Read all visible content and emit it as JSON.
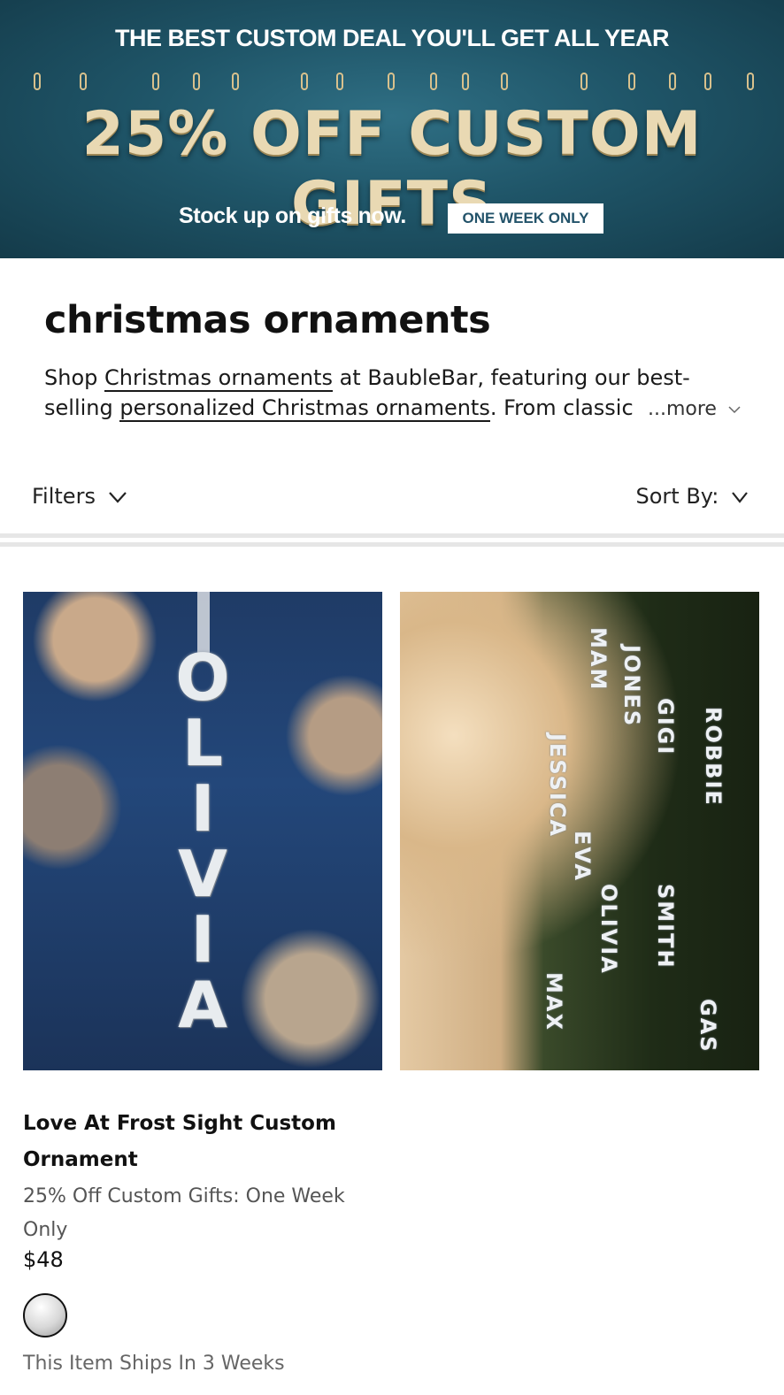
{
  "banner": {
    "kicker": "THE BEST CUSTOM DEAL YOU'LL GET ALL YEAR",
    "headline": "25% OFF CUSTOM GIFTS",
    "subtext": "Stock up on gifts now.",
    "badge": "ONE WEEK ONLY"
  },
  "page": {
    "title": "christmas ornaments",
    "intro_prefix": "Shop ",
    "intro_link1": "Christmas ornaments",
    "intro_mid": " at BaubleBar, featuring our best-selling ",
    "intro_link2": "personalized Christmas ornaments",
    "intro_suffix": ". From classic",
    "more_label": "...more"
  },
  "toolbar": {
    "filters_label": "Filters",
    "sort_label": "Sort By:"
  },
  "product": {
    "name": "Love At Frost Sight Custom Ornament",
    "promo": "25% Off Custom Gifts: One Week Only",
    "price": "$48",
    "shipping": "This Item Ships In 3 Weeks",
    "image_letters": [
      "O",
      "L",
      "I",
      "V",
      "I",
      "A"
    ],
    "tree_tags": [
      "MAM",
      "JONES",
      "GIGI",
      "ROBBIE",
      "JESSICA",
      "EVA",
      "OLIVIA",
      "SMITH",
      "MAX",
      "GAS"
    ]
  },
  "colors": {
    "banner_teal": "#1f5568",
    "badge_text": "#23536a",
    "rule": "#e6e6e6"
  }
}
